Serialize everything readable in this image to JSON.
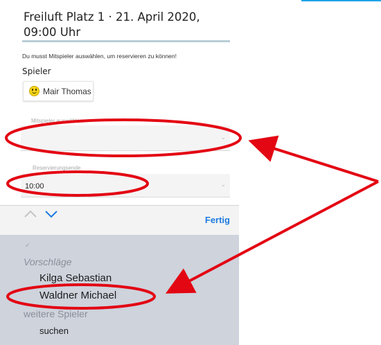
{
  "header": {
    "title_line1": "Freiluft Platz 1 · 21. April 2020,",
    "title_line2": "09:00 Uhr"
  },
  "hint": "Du musst Mitspieler auswählen, um reservieren zu können!",
  "players": {
    "label": "Spieler",
    "selected": [
      {
        "name": "Mair Thomas",
        "icon": "smiley-icon"
      }
    ]
  },
  "player_select": {
    "label": "Mitspieler auswählen",
    "value": ""
  },
  "reservation_end": {
    "label": "Reservierungsende",
    "value": "10:00"
  },
  "toolbar": {
    "prev_icon": "chevron-up-icon",
    "next_icon": "chevron-down-icon",
    "done_label": "Fertig"
  },
  "picker": {
    "suggestions_heading": "Vorschläge",
    "suggestions": [
      "Kilga Sebastian",
      "Waldner Michael"
    ],
    "more_heading": "weitere Spieler",
    "search_label": "suchen"
  },
  "colors": {
    "accent": "#1e7be0",
    "annotation": "#e30613"
  }
}
